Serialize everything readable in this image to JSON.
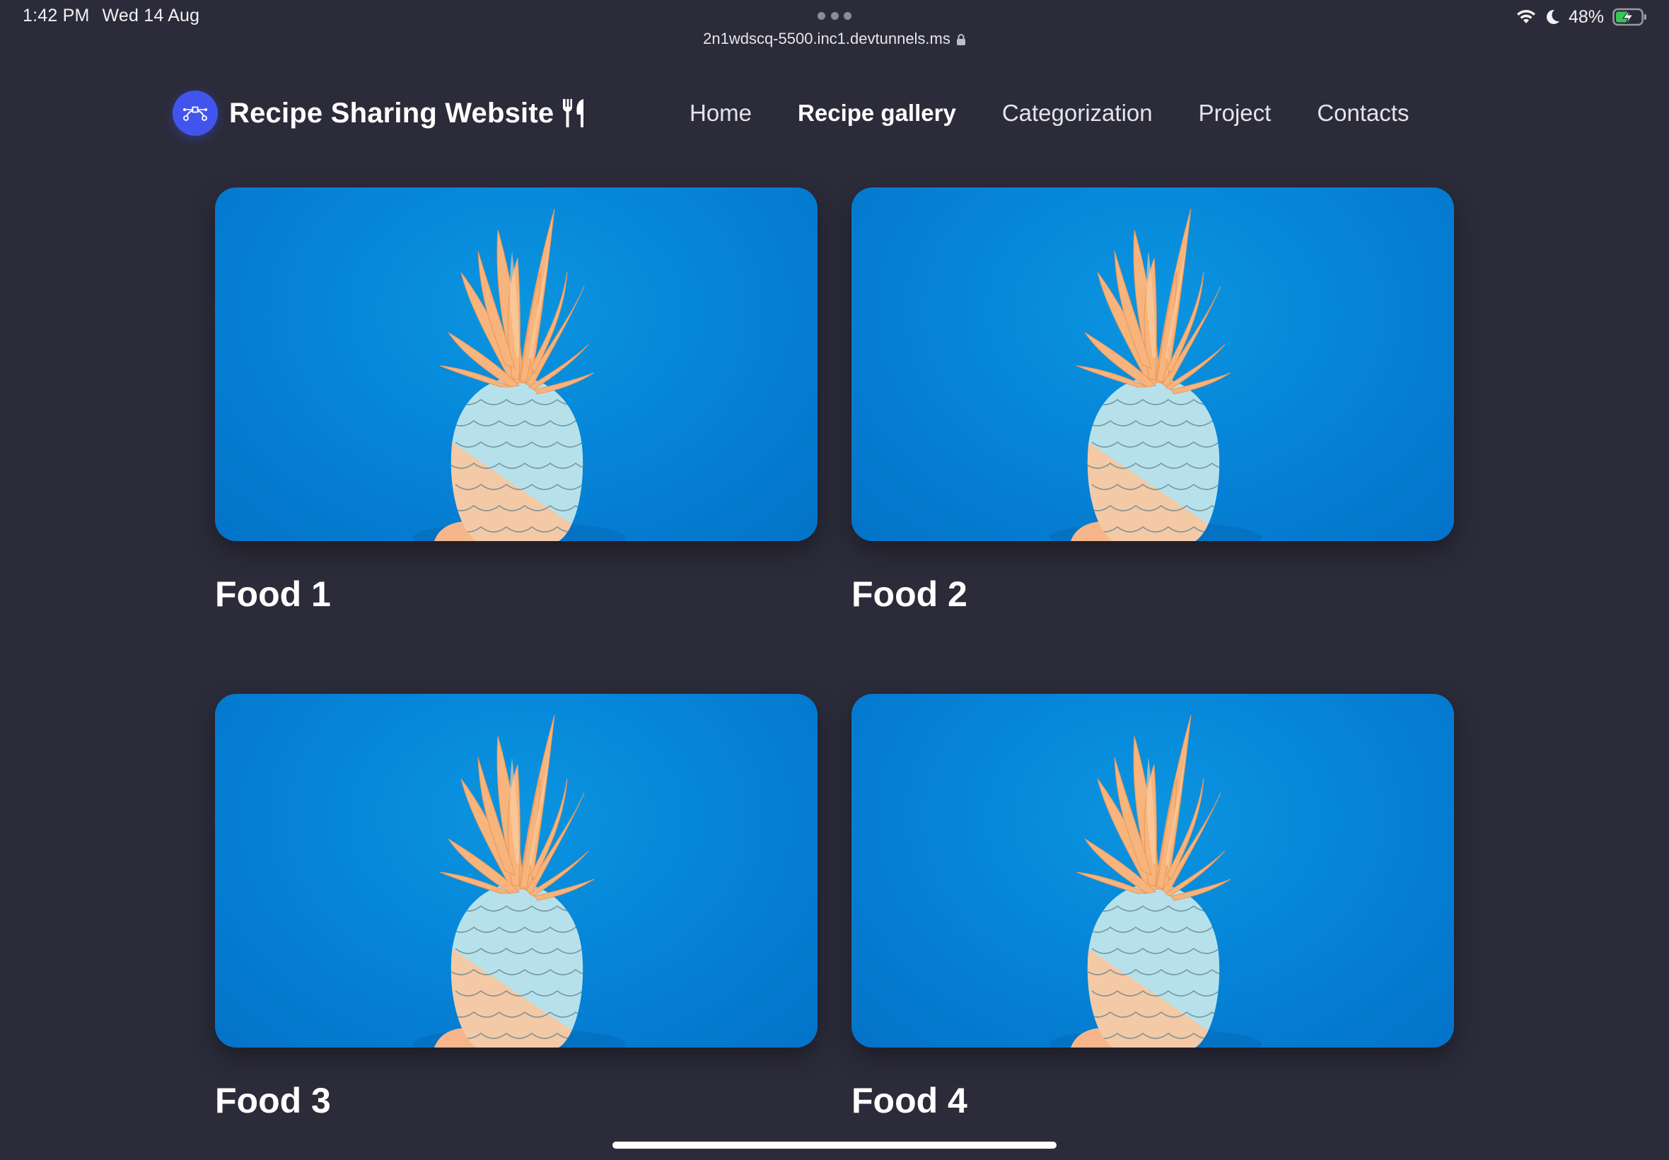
{
  "status_bar": {
    "time": "1:42 PM",
    "date": "Wed 14 Aug",
    "url": "2n1wdscq-5500.inc1.devtunnels.ms",
    "battery": "48%",
    "icons": [
      "wifi-icon",
      "moon-icon",
      "battery-charging-icon",
      "lock-icon"
    ]
  },
  "brand": {
    "name": "Recipe Sharing Website",
    "logo_icon": "bezier-curve-icon",
    "utensils_icon": "fork-knife-icon",
    "logo_color": "#4155ee"
  },
  "nav": {
    "items": [
      {
        "label": "Home",
        "active": false
      },
      {
        "label": "Recipe gallery",
        "active": true
      },
      {
        "label": "Categorization",
        "active": false
      },
      {
        "label": "Project",
        "active": false
      },
      {
        "label": "Contacts",
        "active": false
      }
    ]
  },
  "gallery": {
    "cards": [
      {
        "title": "Food 1",
        "image": "pineapple-photo"
      },
      {
        "title": "Food 2",
        "image": "pineapple-photo"
      },
      {
        "title": "Food 3",
        "image": "pineapple-photo"
      },
      {
        "title": "Food 4",
        "image": "pineapple-photo"
      }
    ]
  },
  "colors": {
    "background": "#2c2b3a",
    "photo_background": "#0685d8"
  }
}
